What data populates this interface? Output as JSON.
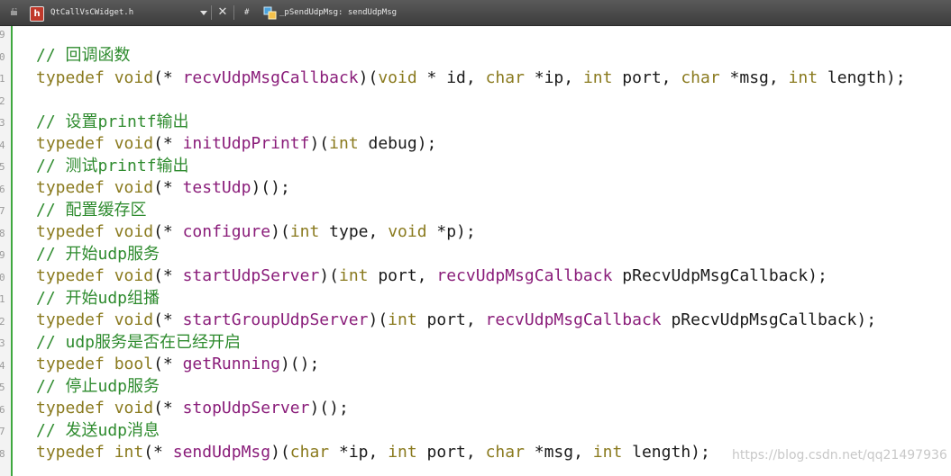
{
  "toolbar": {
    "file_name": "QtCallVsCWidget.h",
    "hash_symbol": "#",
    "symbol_name": "_pSendUdpMsg: sendUdpMsg",
    "file_icon_letter": "h"
  },
  "gutter": {
    "line_numbers": [
      "9",
      "0",
      "1",
      "2",
      "3",
      "4",
      "5",
      "6",
      "7",
      "8",
      "9",
      "0",
      "1",
      "2",
      "3",
      "4",
      "5",
      "6",
      "7",
      "8"
    ]
  },
  "code": {
    "lines": [
      [
        {
          "t": "// 回调函数",
          "c": "cmt"
        }
      ],
      [
        {
          "t": "typedef",
          "c": "kw"
        },
        {
          "t": " "
        },
        {
          "t": "void",
          "c": "kw"
        },
        {
          "t": "(* "
        },
        {
          "t": "recvUdpMsgCallback",
          "c": "fn"
        },
        {
          "t": ")("
        },
        {
          "t": "void",
          "c": "kw"
        },
        {
          "t": " * id, "
        },
        {
          "t": "char",
          "c": "kw"
        },
        {
          "t": " *ip, "
        },
        {
          "t": "int",
          "c": "kw"
        },
        {
          "t": " port, "
        },
        {
          "t": "char",
          "c": "kw"
        },
        {
          "t": " *msg, "
        },
        {
          "t": "int",
          "c": "kw"
        },
        {
          "t": " length);"
        }
      ],
      [],
      [
        {
          "t": "// 设置printf输出",
          "c": "cmt"
        }
      ],
      [
        {
          "t": "typedef",
          "c": "kw"
        },
        {
          "t": " "
        },
        {
          "t": "void",
          "c": "kw"
        },
        {
          "t": "(* "
        },
        {
          "t": "initUdpPrintf",
          "c": "fn"
        },
        {
          "t": ")("
        },
        {
          "t": "int",
          "c": "kw"
        },
        {
          "t": " debug);"
        }
      ],
      [
        {
          "t": "// 测试printf输出",
          "c": "cmt"
        }
      ],
      [
        {
          "t": "typedef",
          "c": "kw"
        },
        {
          "t": " "
        },
        {
          "t": "void",
          "c": "kw"
        },
        {
          "t": "(* "
        },
        {
          "t": "testUdp",
          "c": "fn"
        },
        {
          "t": ")();"
        }
      ],
      [
        {
          "t": "// 配置缓存区",
          "c": "cmt"
        }
      ],
      [
        {
          "t": "typedef",
          "c": "kw"
        },
        {
          "t": " "
        },
        {
          "t": "void",
          "c": "kw"
        },
        {
          "t": "(* "
        },
        {
          "t": "configure",
          "c": "fn"
        },
        {
          "t": ")("
        },
        {
          "t": "int",
          "c": "kw"
        },
        {
          "t": " type, "
        },
        {
          "t": "void",
          "c": "kw"
        },
        {
          "t": " *p);"
        }
      ],
      [
        {
          "t": "// 开始udp服务",
          "c": "cmt"
        }
      ],
      [
        {
          "t": "typedef",
          "c": "kw"
        },
        {
          "t": " "
        },
        {
          "t": "void",
          "c": "kw"
        },
        {
          "t": "(* "
        },
        {
          "t": "startUdpServer",
          "c": "fn"
        },
        {
          "t": ")("
        },
        {
          "t": "int",
          "c": "kw"
        },
        {
          "t": " port, "
        },
        {
          "t": "recvUdpMsgCallback",
          "c": "fn"
        },
        {
          "t": " pRecvUdpMsgCallback);"
        }
      ],
      [
        {
          "t": "// 开始udp组播",
          "c": "cmt"
        }
      ],
      [
        {
          "t": "typedef",
          "c": "kw"
        },
        {
          "t": " "
        },
        {
          "t": "void",
          "c": "kw"
        },
        {
          "t": "(* "
        },
        {
          "t": "startGroupUdpServer",
          "c": "fn"
        },
        {
          "t": ")("
        },
        {
          "t": "int",
          "c": "kw"
        },
        {
          "t": " port, "
        },
        {
          "t": "recvUdpMsgCallback",
          "c": "fn"
        },
        {
          "t": " pRecvUdpMsgCallback);"
        }
      ],
      [
        {
          "t": "// udp服务是否在已经开启",
          "c": "cmt"
        }
      ],
      [
        {
          "t": "typedef",
          "c": "kw"
        },
        {
          "t": " "
        },
        {
          "t": "bool",
          "c": "kw"
        },
        {
          "t": "(* "
        },
        {
          "t": "getRunning",
          "c": "fn"
        },
        {
          "t": ")();"
        }
      ],
      [
        {
          "t": "// 停止udp服务",
          "c": "cmt"
        }
      ],
      [
        {
          "t": "typedef",
          "c": "kw"
        },
        {
          "t": " "
        },
        {
          "t": "void",
          "c": "kw"
        },
        {
          "t": "(* "
        },
        {
          "t": "stopUdpServer",
          "c": "fn"
        },
        {
          "t": ")();"
        }
      ],
      [
        {
          "t": "// 发送udp消息",
          "c": "cmt"
        }
      ],
      [
        {
          "t": "typedef",
          "c": "kw"
        },
        {
          "t": " "
        },
        {
          "t": "int",
          "c": "kw"
        },
        {
          "t": "(* "
        },
        {
          "t": "sendUdpMsg",
          "c": "fn"
        },
        {
          "t": ")("
        },
        {
          "t": "char",
          "c": "kw"
        },
        {
          "t": " *ip, "
        },
        {
          "t": "int",
          "c": "kw"
        },
        {
          "t": " port, "
        },
        {
          "t": "char",
          "c": "kw"
        },
        {
          "t": " *msg, "
        },
        {
          "t": "int",
          "c": "kw"
        },
        {
          "t": " length);"
        }
      ]
    ]
  },
  "watermark": "https://blog.csdn.net/qq21497936"
}
